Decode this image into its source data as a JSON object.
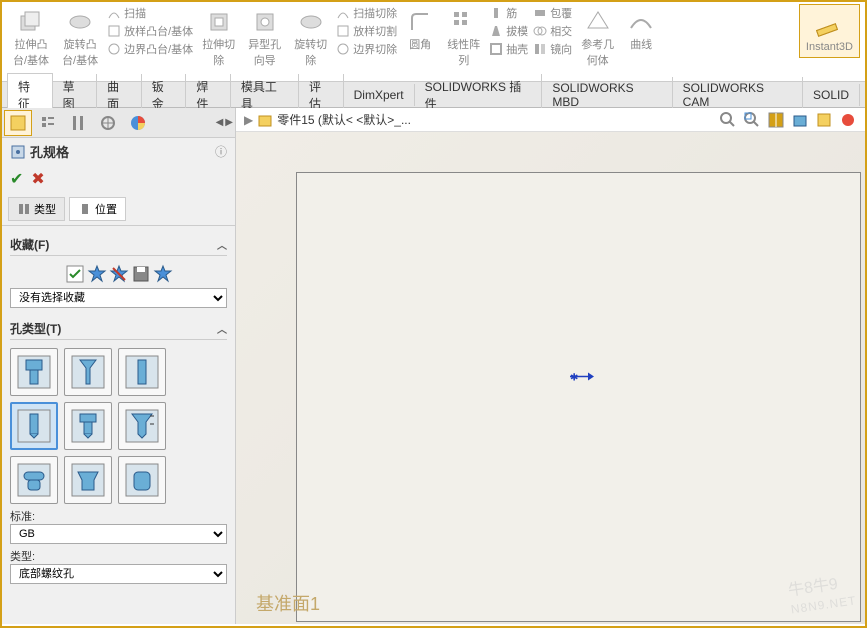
{
  "ribbon": {
    "groups": [
      {
        "big_label": "拉伸凸\n台/基体"
      },
      {
        "big_label": "旋转凸\n台/基体"
      },
      {
        "items": [
          "扫描",
          "放样凸台/基体",
          "边界凸台/基体"
        ]
      },
      {
        "big_label": "拉伸切\n除"
      },
      {
        "big_label": "异型孔\n向导"
      },
      {
        "big_label": "旋转切\n除"
      },
      {
        "items": [
          "扫描切除",
          "放样切割",
          "边界切除"
        ]
      },
      {
        "big_label": "圆角"
      },
      {
        "big_label": "线性阵\n列"
      },
      {
        "items": [
          "筋",
          "拔模",
          "抽壳"
        ]
      },
      {
        "items": [
          "包覆",
          "相交",
          "镜向"
        ]
      },
      {
        "big_label": "参考几\n何体"
      },
      {
        "big_label": "曲线"
      },
      {
        "big_label": "Instant3D",
        "active": true
      }
    ]
  },
  "tabs": [
    "特征",
    "草图",
    "曲面",
    "钣金",
    "焊件",
    "模具工具",
    "评估",
    "DimXpert",
    "SOLIDWORKS 插件",
    "SOLIDWORKS MBD",
    "SOLIDWORKS CAM",
    "SOLID"
  ],
  "active_tab": 0,
  "panel": {
    "title": "孔规格",
    "sub_tabs": [
      {
        "label": "类型"
      },
      {
        "label": "位置"
      }
    ],
    "sections": {
      "favorites": {
        "title": "收藏(F)",
        "select_value": "没有选择收藏"
      },
      "hole_type": {
        "title": "孔类型(T)"
      },
      "standard": {
        "label": "标准:",
        "value": "GB"
      },
      "type": {
        "label": "类型:",
        "value": "底部螺纹孔"
      }
    }
  },
  "viewport": {
    "title": "零件15  (默认< <默认>_...",
    "plane_label": "基准面1",
    "watermark": "牛8牛9"
  }
}
